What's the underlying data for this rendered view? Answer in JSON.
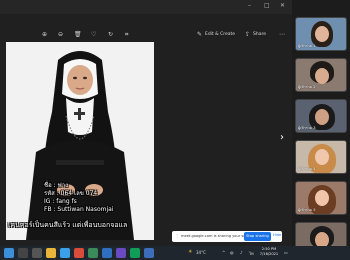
{
  "viewer": {
    "title": "",
    "toolbar": {
      "edit_label": "Edit & Create",
      "share_label": "Share"
    }
  },
  "photo": {
    "caption_lines": [
      "ชื่อ : ฟาง",
      "รหัส : 064 เลข 074",
      "IG : fang fs",
      "FB : Suttiwan Nasomjai",
      "เคนคอร์เป็นคนสีแร้ว แต่เพื่อนบอกจอแล"
    ]
  },
  "participants": [
    {
      "name": "ผู้เข้าร่วม 1",
      "bg": "#6f8fb0"
    },
    {
      "name": "ผู้เข้าร่วม 2",
      "bg": "#8a7a70"
    },
    {
      "name": "ผู้เข้าร่วม 3",
      "bg": "#5a6170"
    },
    {
      "name": "ผู้เข้าร่วม 4",
      "bg": "#c7b9a9"
    },
    {
      "name": "ผู้เข้าร่วม 5",
      "bg": "#9b7a6a"
    },
    {
      "name": "ผู้เข้าร่วม 6",
      "bg": "#7b6c63"
    }
  ],
  "share_banner": {
    "text": "meet.google.com is sharing your screen",
    "stop_label": "Stop sharing",
    "hide_label": "Hide"
  },
  "taskbar": {
    "weather": "34°C",
    "time": "2:50 PM",
    "date": "7/16/2021"
  },
  "colors": {
    "accent": "#1a73e8",
    "taskbar": "#20262e"
  }
}
